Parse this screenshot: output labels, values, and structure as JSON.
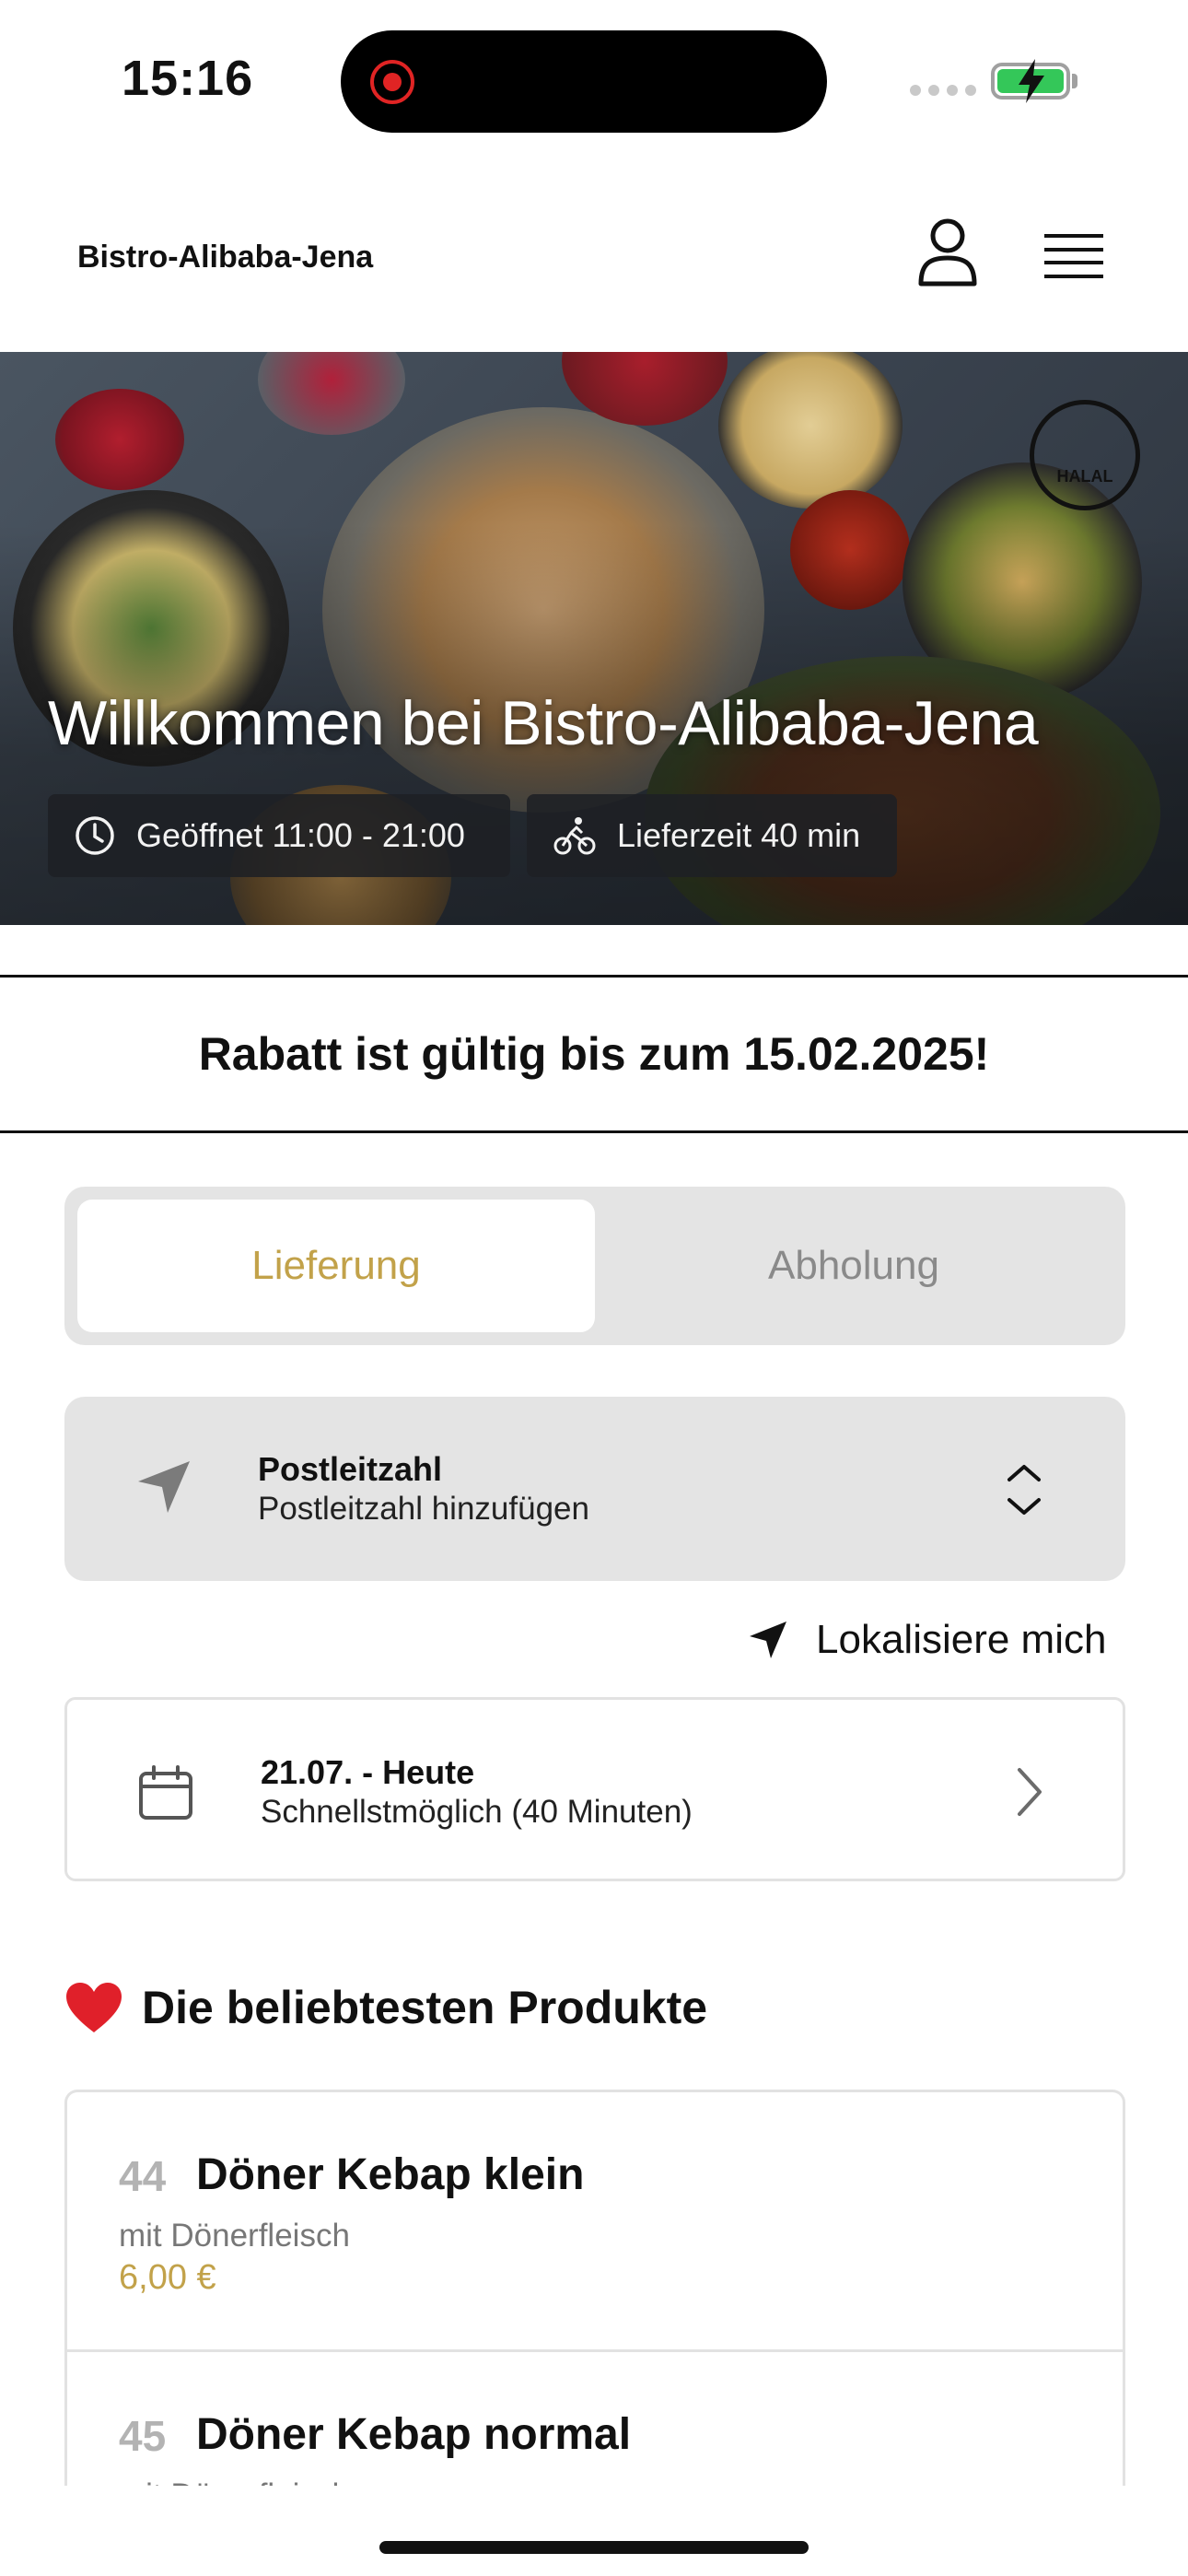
{
  "status_bar": {
    "time": "15:16",
    "icons": [
      "record-icon",
      "signal-dots-icon",
      "battery-charging-icon"
    ]
  },
  "header": {
    "brand": "Bistro-Alibaba-Jena",
    "icons": [
      "user-icon",
      "hamburger-menu-icon"
    ]
  },
  "hero": {
    "title": "Willkommen bei Bistro-Alibaba-Jena",
    "opening_hours": "Geöffnet 11:00 - 21:00",
    "delivery_time": "Lieferzeit 40 min",
    "badge_text": "HALAL"
  },
  "promo": {
    "text": "Rabatt ist gültig bis zum 15.02.2025!"
  },
  "order_mode": {
    "options": [
      "Lieferung",
      "Abholung"
    ],
    "selected": "Lieferung"
  },
  "postcode": {
    "label": "Postleitzahl",
    "placeholder": "Postleitzahl hinzufügen"
  },
  "locate": {
    "label": "Lokalisiere mich"
  },
  "schedule": {
    "date": "21.07. - Heute",
    "time": "Schnellstmöglich (40 Minuten)"
  },
  "popular": {
    "emoji": "❤️",
    "title": "Die beliebtesten Produkte",
    "products": [
      {
        "number": "44",
        "name": "Döner Kebap klein",
        "description": "mit Dönerfleisch",
        "price": "6,00 €"
      },
      {
        "number": "45",
        "name": "Döner Kebap normal",
        "description": "mit Dönerfleisch",
        "price": ""
      }
    ]
  },
  "colors": {
    "accent_gold": "#c2a24a",
    "panel_gray": "#e4e4e4",
    "muted_text": "#8a8a8a"
  }
}
